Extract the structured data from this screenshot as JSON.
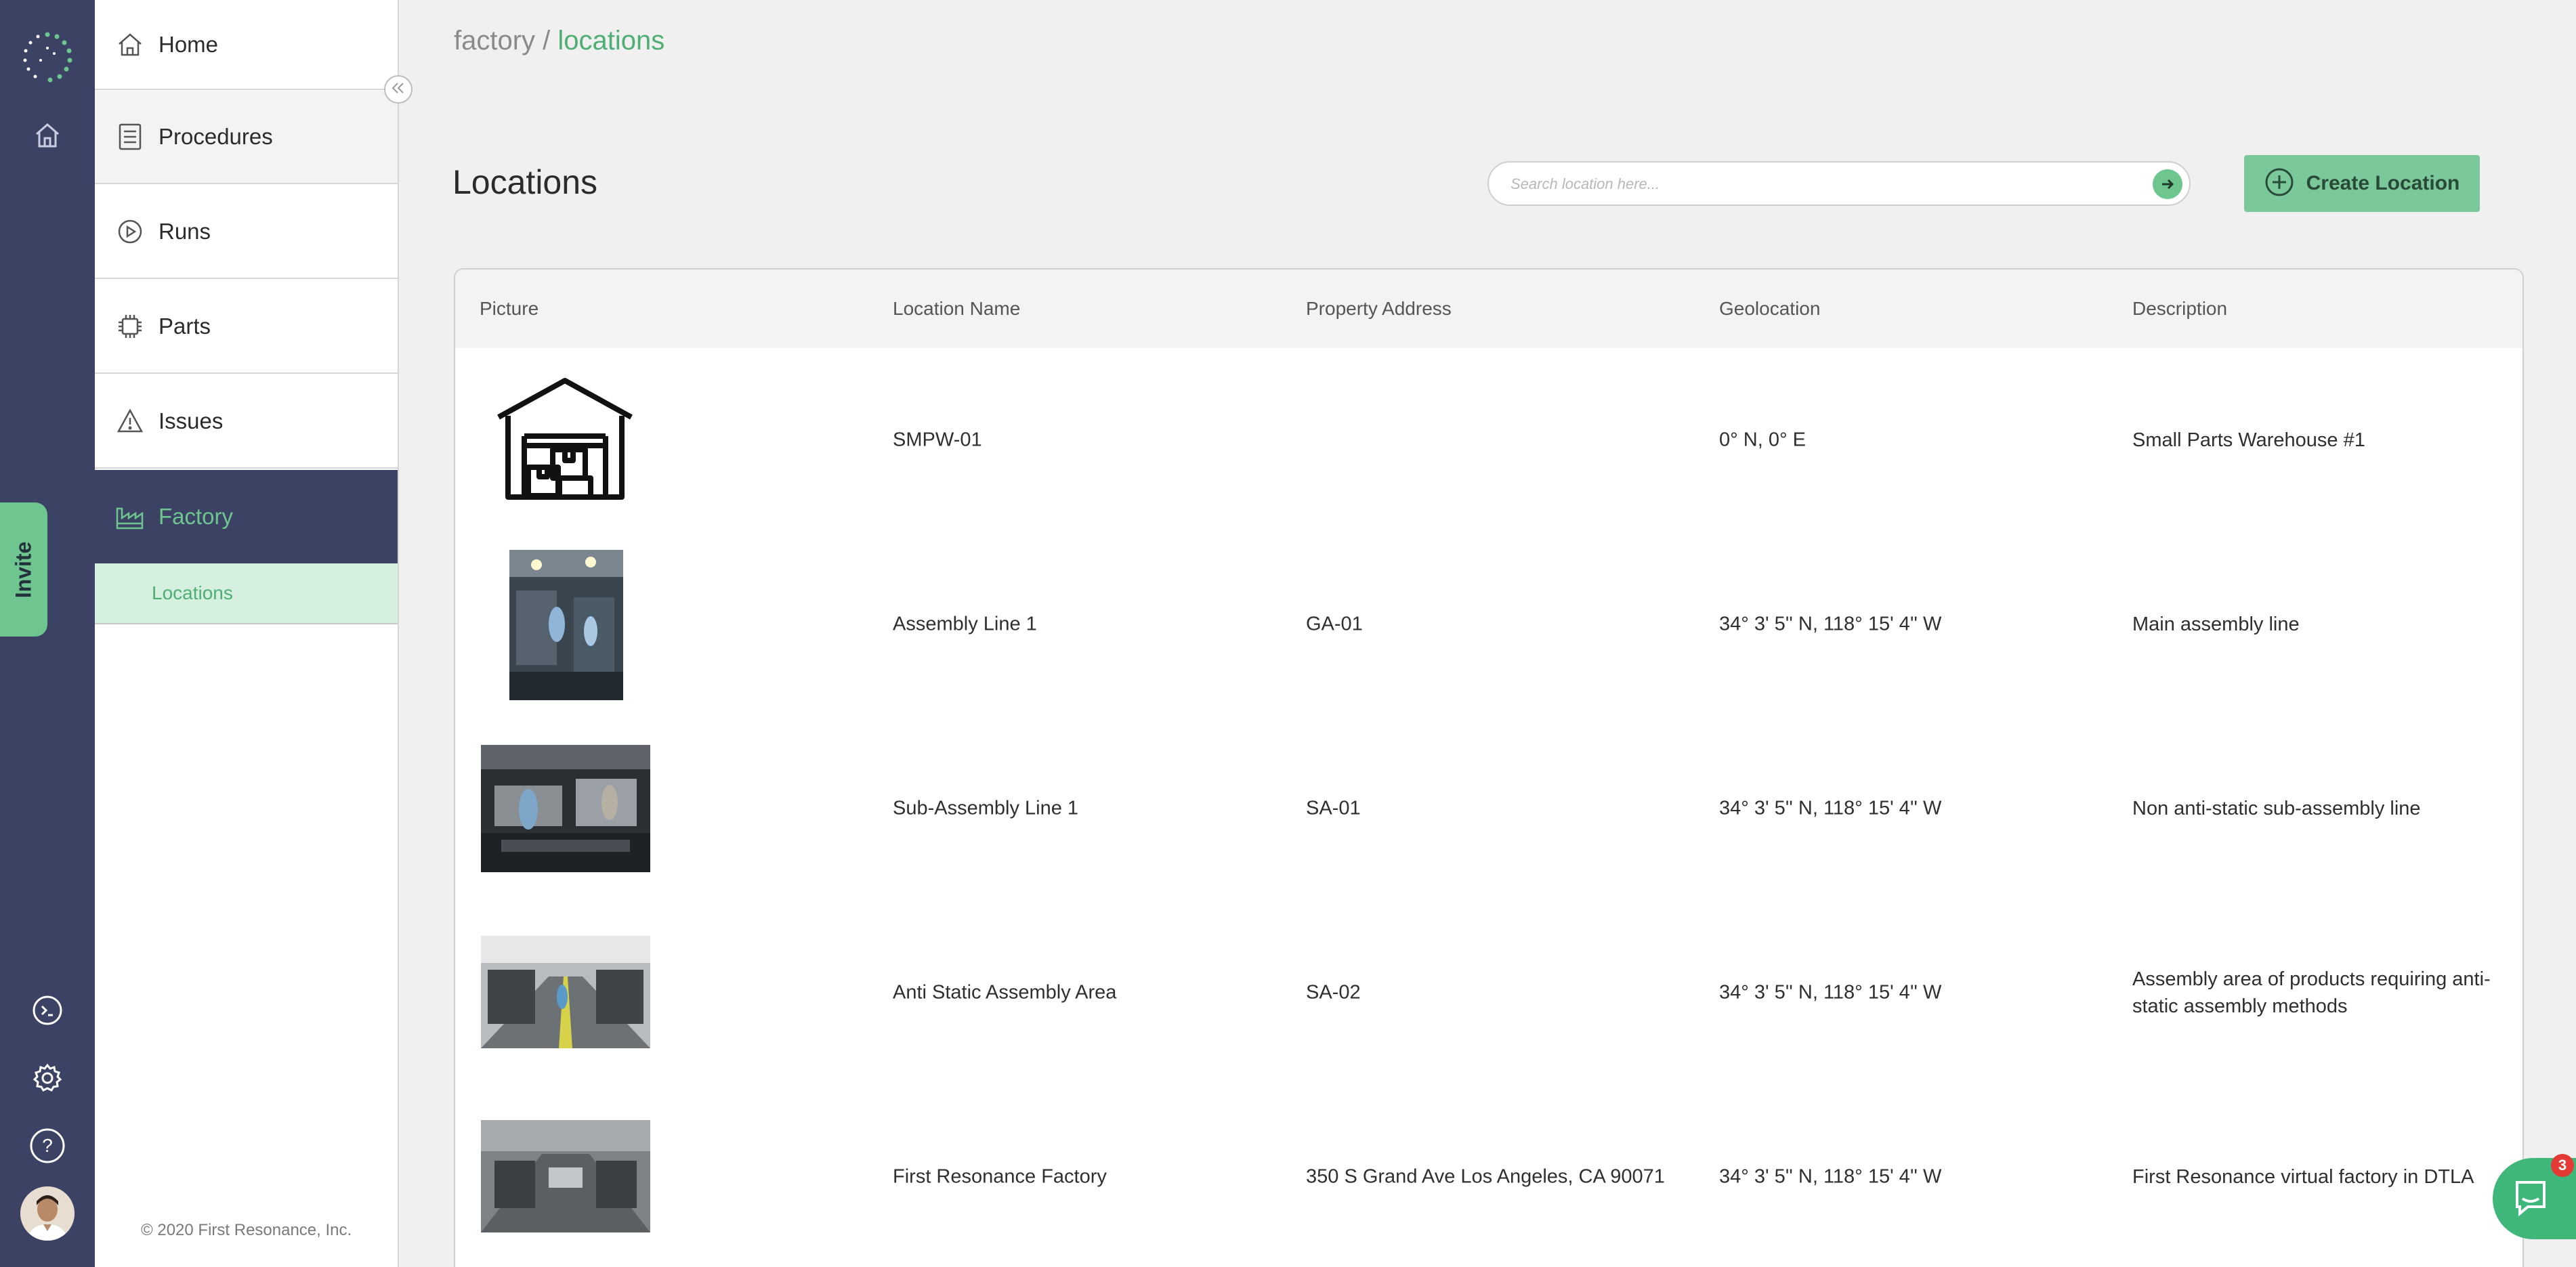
{
  "breadcrumb": {
    "root": "factory",
    "separator": "/",
    "current": "locations"
  },
  "sidebar": {
    "items": [
      {
        "label": "Home",
        "icon": "home-icon"
      },
      {
        "label": "Procedures",
        "icon": "document-icon"
      },
      {
        "label": "Runs",
        "icon": "play-circle-icon"
      },
      {
        "label": "Parts",
        "icon": "chip-icon"
      },
      {
        "label": "Issues",
        "icon": "warning-icon"
      },
      {
        "label": "Factory",
        "icon": "factory-icon"
      }
    ],
    "sub_item": "Locations",
    "copyright": "© 2020 First Resonance, Inc."
  },
  "rail": {
    "invite_label": "Invite"
  },
  "page": {
    "title": "Locations",
    "search_placeholder": "Search location here...",
    "create_button": "Create Location"
  },
  "table": {
    "headers": [
      "Picture",
      "Location Name",
      "Property Address",
      "Geolocation",
      "Description"
    ],
    "rows": [
      {
        "name": "SMPW-01",
        "address": "",
        "geo": "0° N, 0° E",
        "desc": "Small Parts Warehouse #1"
      },
      {
        "name": "Assembly Line 1",
        "address": "GA-01",
        "geo": "34° 3' 5'' N, 118° 15' 4'' W",
        "desc": "Main assembly line"
      },
      {
        "name": "Sub-Assembly Line 1",
        "address": "SA-01",
        "geo": "34° 3' 5'' N, 118° 15' 4'' W",
        "desc": "Non anti-static sub-assembly line"
      },
      {
        "name": "Anti Static Assembly Area",
        "address": "SA-02",
        "geo": "34° 3' 5'' N, 118° 15' 4'' W",
        "desc": "Assembly area of products requiring anti-static assembly methods"
      },
      {
        "name": "First Resonance Factory",
        "address": "350 S Grand Ave Los Angeles, CA 90071",
        "geo": "34° 3' 5'' N, 118° 15' 4'' W",
        "desc": "First Resonance virtual factory in DTLA"
      }
    ]
  },
  "chat": {
    "badge_count": "3"
  },
  "colors": {
    "rail": "#3b4264",
    "accent": "#6ec58f",
    "active_text": "#6ec58f"
  }
}
